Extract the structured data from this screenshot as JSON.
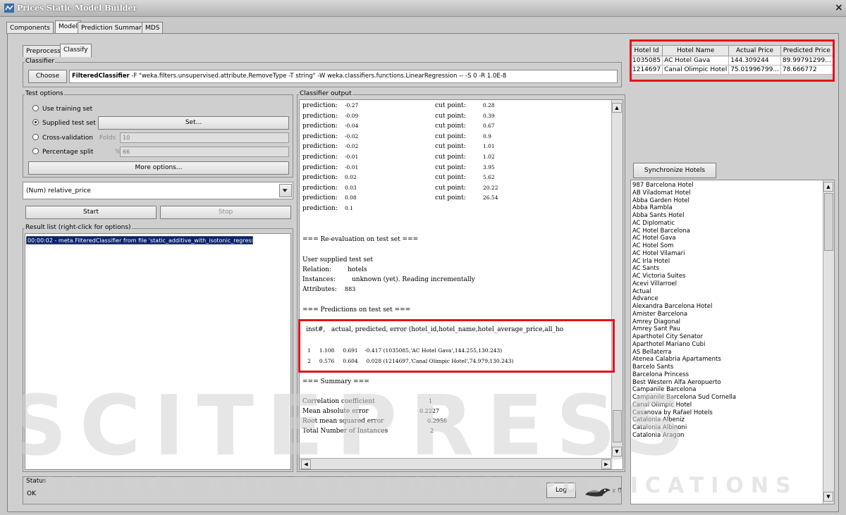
{
  "window": {
    "title": "Prices Static Model Builder",
    "close": "×"
  },
  "top_tabs": [
    "Components",
    "Model",
    "Prediction Summary",
    "MDS"
  ],
  "sub_tabs": [
    "Preprocess",
    "Classify"
  ],
  "classifier": {
    "group_label": "Classifier",
    "choose_label": "Choose",
    "name": "FilteredClassifier",
    "args": " -F \"weka.filters.unsupervised.attribute.RemoveType -T string\" -W weka.classifiers.functions.LinearRegression -- -S 0 -R 1.0E-8"
  },
  "test_options": {
    "group_label": "Test options",
    "use_training": "Use training set",
    "supplied_test": "Supplied test set",
    "set_button": "Set...",
    "cross_validation": "Cross-validation",
    "folds_label": "Folds",
    "folds_value": "10",
    "percentage_split": "Percentage split",
    "percent_label": "%",
    "percent_value": "66",
    "more_options": "More options..."
  },
  "class_attribute": "(Num) relative_price",
  "start_label": "Start",
  "stop_label": "Stop",
  "result_list": {
    "group_label": "Result list (right-click for options)",
    "items": [
      "00:00:02 - meta.FilteredClassifier from file 'static_additive_with_isotonic_regression.model'"
    ]
  },
  "output": {
    "group_label": "Classifier output",
    "predictions": [
      {
        "label": "prediction:",
        "value": "-0.27",
        "cp_label": "cut point:",
        "cp": "0.28"
      },
      {
        "label": "prediction:",
        "value": "-0.09",
        "cp_label": "cut point:",
        "cp": "0.39"
      },
      {
        "label": "prediction:",
        "value": "-0.04",
        "cp_label": "cut point:",
        "cp": "0.67"
      },
      {
        "label": "prediction:",
        "value": "-0.02",
        "cp_label": "cut point:",
        "cp": "0.9"
      },
      {
        "label": "prediction:",
        "value": "-0.02",
        "cp_label": "cut point:",
        "cp": "1.01"
      },
      {
        "label": "prediction:",
        "value": "-0.01",
        "cp_label": "cut point:",
        "cp": "1.02"
      },
      {
        "label": "prediction:",
        "value": "-0.01",
        "cp_label": "cut point:",
        "cp": "3.95"
      },
      {
        "label": "prediction:",
        "value": "0.02",
        "cp_label": "cut point:",
        "cp": "5.62"
      },
      {
        "label": "prediction:",
        "value": "0.03",
        "cp_label": "cut point:",
        "cp": "20.22"
      },
      {
        "label": "prediction:",
        "value": "0.08",
        "cp_label": "cut point:",
        "cp": "26.54"
      },
      {
        "label": "prediction:",
        "value": "0.1",
        "cp_label": "",
        "cp": ""
      }
    ],
    "reeval_header": "=== Re-evaluation on test set ===",
    "user_supplied": "User supplied test set",
    "relation_label": "Relation:",
    "relation_value": "hotels",
    "instances_label": "Instances:",
    "instances_value": "unknown (yet). Reading incrementally",
    "attributes_label": "Attributes:",
    "attributes_value": "883",
    "pred_header": "=== Predictions on test set ===",
    "pred_columns": "inst#,   actual, predicted, error (hotel_id,hotel_name,hotel_average_price,all_ho",
    "pred_rows": [
      "   1     1.108     0.691    -0.417 (1035085,'AC Hotel Gava',144.255,130.243)",
      "   2     0.576     0.604     0.028 (1214697,'Canal Olimpic Hotel',74.979,130.243)"
    ],
    "summary_header": "=== Summary ===",
    "summary": [
      {
        "label": "Correlation coefficient",
        "value": "1"
      },
      {
        "label": "Mean absolute error",
        "value": "0.2227"
      },
      {
        "label": "Root mean squared error",
        "value": "0.2956"
      },
      {
        "label": "Total Number of Instances",
        "value": "2"
      }
    ]
  },
  "hotel_table": {
    "columns": [
      "Hotel Id",
      "Hotel Name",
      "Actual Price",
      "Predicted Price"
    ],
    "rows": [
      [
        "1035085",
        "AC Hotel Gava",
        "144.309244",
        "89.99791299..."
      ],
      [
        "1214697",
        "Canal Olimpic Hotel",
        "75.01996799...",
        "78.666772"
      ]
    ]
  },
  "sync_label": "Synchronize Hotels",
  "hotels": [
    "987 Barcelona Hotel",
    "AB Viladomat Hotel",
    "Abba Garden Hotel",
    "Abba Rambla",
    "Abba Sants Hotel",
    "AC Diplomatic",
    "AC Hotel Barcelona",
    "AC Hotel Gava",
    "AC Hotel Som",
    "AC Hotel Vilamari",
    "AC Irla Hotel",
    "AC Sants",
    "AC Victoria Suites",
    "Acevi Villarroel",
    "Actual",
    "Advance",
    "Alexandra Barcelona Hotel",
    "Amister Barcelona",
    "Amrey Diagonal",
    "Amrey Sant Pau",
    "Aparthotel City Senator",
    "Aparthotel Mariano Cubi",
    "AS Bellaterra",
    "Atenea Calabria Apartaments",
    "Barcelo Sants",
    "Barcelona Princess",
    "Best Western Alfa Aeropuerto",
    "Campanile Barcelona",
    "Campanile Barcelona Sud Cornella",
    "Canal Olimpic Hotel",
    "Casanova by Rafael Hotels",
    "Catalonia Albeniz",
    "Catalonia Albinoni",
    "Catalonia Aragon"
  ],
  "status": {
    "label": "Status",
    "value": "OK",
    "log_label": "Log",
    "x_count": "x 0"
  },
  "watermarks": {
    "big": "SCITEPRESS",
    "small": "SCIENCE AND TECHNOLOGY PUBLICATIONS"
  },
  "colors": {
    "highlight_red": "#e0141c",
    "selection_blue": "#0a246a"
  }
}
